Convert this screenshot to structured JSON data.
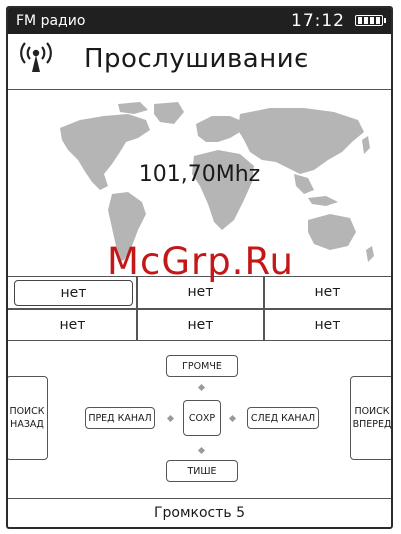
{
  "status_bar": {
    "app_title": "FM радио",
    "time": "17:12",
    "battery_icon": "battery-full-icon"
  },
  "header": {
    "icon": "radio-signal-icon",
    "title": "Прослушиваниє"
  },
  "tuner": {
    "frequency": "101,70Mhz",
    "background": "world-map"
  },
  "presets": [
    {
      "label": "нет",
      "selected": true
    },
    {
      "label": "нет",
      "selected": false
    },
    {
      "label": "нет",
      "selected": false
    },
    {
      "label": "нет",
      "selected": false
    },
    {
      "label": "нет",
      "selected": false
    },
    {
      "label": "нет",
      "selected": false
    }
  ],
  "controls": {
    "search_back": "ПОИСК НАЗАД",
    "search_forward": "ПОИСК ВПЕРЕД",
    "louder": "ГРОМЧЕ",
    "quieter": "ТИШЕ",
    "prev_channel": "ПРЕД КАНАЛ",
    "next_channel": "СЛЕД КАНАЛ",
    "save": "СОХР"
  },
  "footer": {
    "volume": "Громкость 5"
  },
  "watermark": "McGrp.Ru",
  "colors": {
    "status_bar_bg": "#202020",
    "watermark": "#c41818",
    "map": "#b5b5b5"
  }
}
